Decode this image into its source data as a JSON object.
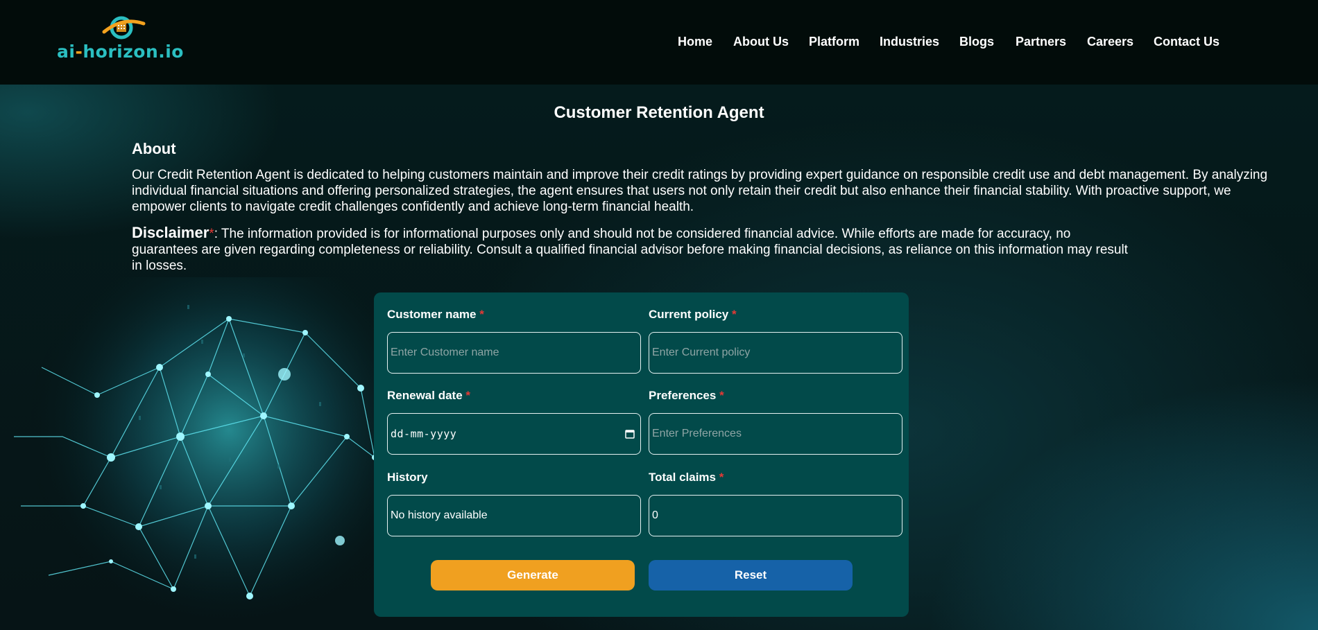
{
  "header": {
    "logo_text_part1": "ai",
    "logo_text_dash": "-",
    "logo_text_part2": "horizon.io",
    "nav": [
      "Home",
      "About Us",
      "Platform",
      "Industries",
      "Blogs",
      "Partners",
      "Careers",
      "Contact Us"
    ]
  },
  "main": {
    "title": "Customer Retention Agent",
    "about_heading": "About",
    "about_text": "Our Credit Retention Agent is dedicated to helping customers maintain and improve their credit ratings by providing expert guidance on responsible credit use and debt management. By analyzing individual financial situations and offering personalized strategies, the agent ensures that users not only retain their credit but also enhance their financial stability. With proactive support, we empower clients to navigate credit challenges confidently and achieve long-term financial health.",
    "disclaimer_label": "Disclaimer",
    "disclaimer_star": "*",
    "disclaimer_text": ": The information provided is for informational purposes only and should not be considered financial advice. While efforts are made for accuracy, no guarantees are given regarding completeness or reliability. Consult a qualified financial advisor before making financial decisions, as reliance on this information may result in losses."
  },
  "form": {
    "required_mark": "*",
    "customer_name": {
      "label": "Customer name",
      "placeholder": "Enter Customer name"
    },
    "current_policy": {
      "label": "Current policy",
      "placeholder": "Enter Current policy"
    },
    "renewal_date": {
      "label": "Renewal date",
      "placeholder": "dd-mm-yyyy"
    },
    "preferences": {
      "label": "Preferences",
      "placeholder": "Enter Preferences"
    },
    "history": {
      "label": "History",
      "value": "No history available"
    },
    "total_claims": {
      "label": "Total claims",
      "value": "0"
    },
    "generate_label": "Generate",
    "reset_label": "Reset"
  },
  "colors": {
    "accent_orange": "#f0a020",
    "accent_blue": "#1662a8",
    "form_bg": "#024a4a",
    "logo_teal": "#2bbfc1",
    "required_red": "#e53935"
  }
}
